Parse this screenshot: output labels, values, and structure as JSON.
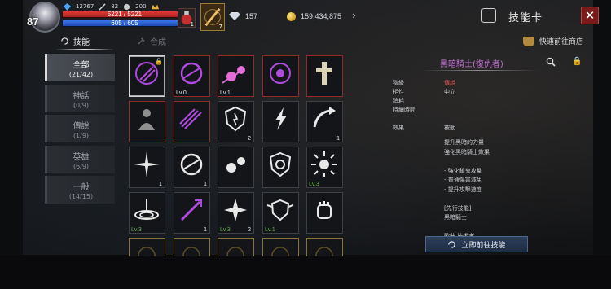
{
  "hud": {
    "level": "87",
    "stats": {
      "gems_small": "12767",
      "stat_a": "82",
      "stat_b": "200"
    },
    "hp": {
      "text": "5221 / 5221",
      "fill": 1.0
    },
    "mp": {
      "text": "605 / 605",
      "fill": 1.0
    },
    "potion_count": "1",
    "skill_slot_count": "7",
    "currency_gem": "157",
    "currency_gold": "159,434,875",
    "page_title": "技能卡",
    "close_label": "✕"
  },
  "tabs": {
    "active_label": "技能",
    "inactive_label": "合成",
    "shop_label": "快速前往商店"
  },
  "categories": [
    {
      "name": "全部",
      "count": "(21/42)",
      "active": true
    },
    {
      "name": "神話",
      "count": "(0/9)",
      "active": false
    },
    {
      "name": "傳說",
      "count": "(1/9)",
      "active": false
    },
    {
      "name": "英雄",
      "count": "(6/9)",
      "active": false
    },
    {
      "name": "一般",
      "count": "(14/15)",
      "active": false
    }
  ],
  "cards": [
    {
      "icon": "dark-claw-icon",
      "frame": "selected",
      "lv": "",
      "cnt": "",
      "lock": true,
      "color": "#b04be0"
    },
    {
      "icon": "purple-slash-icon",
      "frame": "red",
      "lv": "Lv.0",
      "cnt": "",
      "lock": false,
      "color": "#b04be0"
    },
    {
      "icon": "pink-fireball-icon",
      "frame": "red",
      "lv": "Lv.1",
      "cnt": "",
      "lock": false,
      "color": "#e46bd8"
    },
    {
      "icon": "purple-eye-icon",
      "frame": "red",
      "lv": "",
      "cnt": "",
      "lock": false,
      "color": "#b04be0"
    },
    {
      "icon": "cross-pillar-icon",
      "frame": "red",
      "lv": "",
      "cnt": "",
      "lock": false,
      "color": "#d9d2b4"
    },
    {
      "icon": "shadow-figure-icon",
      "frame": "red",
      "lv": "",
      "cnt": "",
      "lock": false,
      "color": "#8f8f8f"
    },
    {
      "icon": "purple-claws-icon",
      "frame": "red",
      "lv": "",
      "cnt": "",
      "lock": false,
      "color": "#b04be0"
    },
    {
      "icon": "shield-icon",
      "frame": "normal",
      "lv": "",
      "cnt": "2",
      "lock": false,
      "color": "#e8e8e8"
    },
    {
      "icon": "lightning-icon",
      "frame": "normal",
      "lv": "",
      "cnt": "",
      "lock": false,
      "color": "#e8e8e8"
    },
    {
      "icon": "curved-arrow-icon",
      "frame": "normal",
      "lv": "",
      "cnt": "1",
      "lock": false,
      "color": "#e8e8e8"
    },
    {
      "icon": "burst-icon",
      "frame": "normal",
      "lv": "",
      "cnt": "1",
      "lock": false,
      "color": "#e8e8e8"
    },
    {
      "icon": "white-slash-icon",
      "frame": "normal",
      "lv": "",
      "cnt": "1",
      "lock": false,
      "color": "#e8e8e8"
    },
    {
      "icon": "white-fireball-icon",
      "frame": "normal",
      "lv": "",
      "cnt": "",
      "lock": false,
      "color": "#e8e8e8"
    },
    {
      "icon": "shield-emblem-icon",
      "frame": "normal",
      "lv": "",
      "cnt": "",
      "lock": false,
      "color": "#e8e8e8"
    },
    {
      "icon": "radiant-sun-icon",
      "frame": "normal",
      "lv": "Lv.3",
      "cnt": "",
      "lock": false,
      "color": "#e8e8e8"
    },
    {
      "icon": "shockwave-icon",
      "frame": "normal",
      "lv": "Lv.3",
      "cnt": "",
      "lock": false,
      "color": "#e8e8e8"
    },
    {
      "icon": "purple-sword-icon",
      "frame": "normal",
      "lv": "",
      "cnt": "1",
      "lock": false,
      "color": "#b04be0"
    },
    {
      "icon": "star-explosion-icon",
      "frame": "normal",
      "lv": "Lv.3",
      "cnt": "2",
      "lock": false,
      "color": "#e8e8e8"
    },
    {
      "icon": "wing-shield-icon",
      "frame": "normal",
      "lv": "Lv.1",
      "cnt": "",
      "lock": false,
      "color": "#e8e8e8"
    },
    {
      "icon": "fist-icon",
      "frame": "normal",
      "lv": "",
      "cnt": "",
      "lock": false,
      "color": "#e8e8e8"
    },
    {
      "icon": "faded-icon",
      "frame": "gold",
      "lv": "",
      "cnt": "",
      "lock": false,
      "color": "#8a7134"
    },
    {
      "icon": "faded-icon",
      "frame": "gold",
      "lv": "",
      "cnt": "",
      "lock": false,
      "color": "#8a7134"
    },
    {
      "icon": "faded-icon",
      "frame": "gold",
      "lv": "",
      "cnt": "",
      "lock": false,
      "color": "#8a7134"
    },
    {
      "icon": "faded-icon",
      "frame": "gold",
      "lv": "",
      "cnt": "",
      "lock": false,
      "color": "#8a7134"
    },
    {
      "icon": "faded-icon",
      "frame": "gold",
      "lv": "",
      "cnt": "",
      "lock": false,
      "color": "#8a7134"
    }
  ],
  "detail": {
    "title": "黑暗騎士(復仇者)",
    "rows": [
      {
        "label": "階級",
        "value": "傳說",
        "red": true
      },
      {
        "label": "相性",
        "value": "中立",
        "red": false
      },
      {
        "label": "消耗",
        "value": "",
        "red": false
      },
      {
        "label": "持續時間",
        "value": "",
        "red": false
      }
    ],
    "effect_label": "效果",
    "effect_type": "被動",
    "description": "提升黑暗的力量\n強化黑暗騎士效果\n\n- 強化鎖鬼攻擊\n- 普通傷害減免\n- 提升攻擊速度\n\n[先行技能]\n黑暗騎士\n\n歌曲 技術者",
    "goto_label": "立即前往技能"
  }
}
